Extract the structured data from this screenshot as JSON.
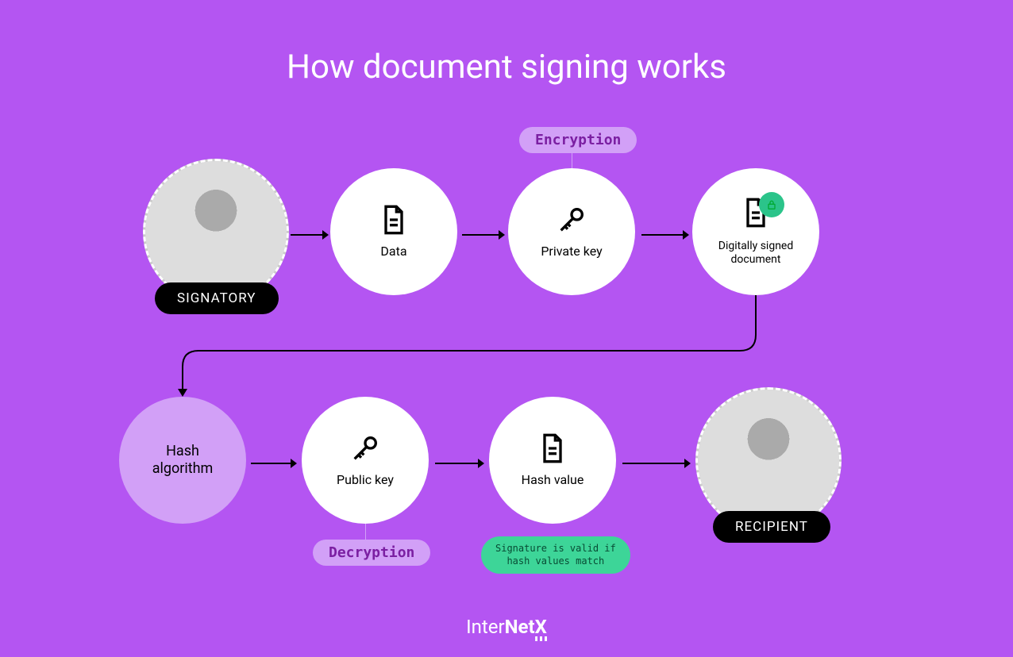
{
  "title": "How document signing works",
  "signatory_label": "SIGNATORY",
  "recipient_label": "RECIPIENT",
  "encryption_tag": "Encryption",
  "decryption_tag": "Decryption",
  "hash_valid_tag": "Signature is valid if\nhash values match",
  "nodes": {
    "data": "Data",
    "private_key": "Private key",
    "signed_doc": "Digitally signed document",
    "hash_algo": "Hash algorithm",
    "public_key": "Public key",
    "hash_value": "Hash value"
  },
  "brand": {
    "part1": "Inter",
    "part2": "Net",
    "part3": "X"
  },
  "colors": {
    "bg": "#b455f2",
    "lilac": "#d2a0f7",
    "green": "#3dd598",
    "black": "#000000",
    "white": "#ffffff"
  }
}
